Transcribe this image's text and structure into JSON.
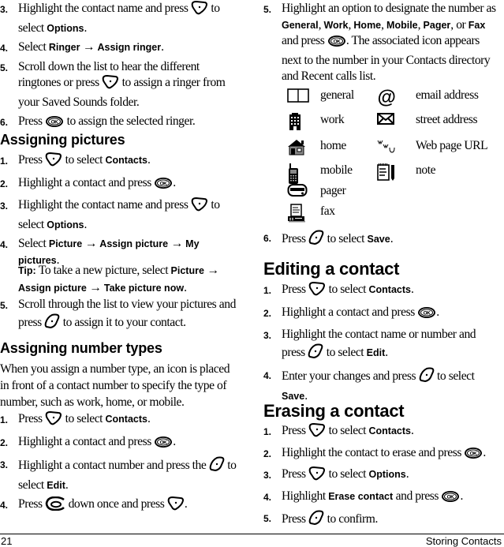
{
  "left": {
    "ringer_steps": [
      {
        "num": "3.",
        "parts": [
          "Highlight the contact name and press ",
          "{softkey-right}",
          " to select ",
          "**Options",
          "."
        ]
      },
      {
        "num": "4.",
        "parts": [
          "Select ",
          "**Ringer",
          " → ",
          "**Assign ringer",
          "."
        ]
      },
      {
        "num": "5.",
        "parts": [
          "Scroll down the list to hear the different ringtones or press ",
          "{softkey-right}",
          " to assign a ringer from your Saved Sounds folder."
        ]
      },
      {
        "num": "6.",
        "parts": [
          "Press ",
          "{ok}",
          " to assign the selected ringer."
        ]
      }
    ],
    "pictures_heading": "Assigning pictures",
    "pictures_steps": [
      {
        "num": "1.",
        "parts": [
          "Press ",
          "{softkey-right}",
          " to select ",
          "**Contacts",
          "."
        ]
      },
      {
        "num": "2.",
        "parts": [
          "Highlight a contact and press ",
          "{ok}",
          "."
        ]
      },
      {
        "num": "3.",
        "parts": [
          "Highlight the contact name and press ",
          "{softkey-right}",
          " to select ",
          "**Options",
          "."
        ]
      },
      {
        "num": "4.",
        "parts": [
          "Select ",
          "**Picture",
          " → ",
          "**Assign picture",
          " → ",
          "**My pictures",
          "."
        ]
      }
    ],
    "tip": {
      "label": "Tip:",
      "parts": [
        " To take a new picture, select ",
        "**Picture",
        " → ",
        "**Assign picture",
        " → ",
        "**Take picture now",
        "."
      ]
    },
    "pictures_step5": {
      "num": "5.",
      "parts": [
        "Scroll through the list to view your pictures and press ",
        "{softkey-left}",
        " to assign it to your contact."
      ]
    },
    "number_types_heading": "Assigning number types",
    "number_types_intro": "When you assign a number type, an icon is placed in front of a contact number to specify the type of number, such as work, home, or mobile.",
    "number_types_steps": [
      {
        "num": "1.",
        "parts": [
          "Press ",
          "{softkey-right}",
          " to select ",
          "**Contacts",
          "."
        ]
      },
      {
        "num": "2.",
        "parts": [
          "Highlight a contact and press ",
          "{ok}",
          "."
        ]
      },
      {
        "num": "3.",
        "parts": [
          "Highlight a contact number and press the ",
          "{softkey-left}",
          " to select ",
          "**Edit",
          "."
        ]
      },
      {
        "num": "4.",
        "parts": [
          "Press ",
          "{nav}",
          " down once and press ",
          "{softkey-right}",
          "."
        ]
      }
    ]
  },
  "right": {
    "number_types_step5": {
      "num": "5.",
      "parts": [
        "Highlight an option to designate the number as ",
        "**General",
        ", ",
        "**Work",
        ", ",
        "**Home",
        ", ",
        "**Mobile",
        ", ",
        "**Pager",
        ", or ",
        "**Fax",
        " and press ",
        "{ok}",
        ". The associated icon appears next to the number in your Contacts directory and Recent calls list."
      ]
    },
    "icon_table": [
      {
        "icon1": "book-icon",
        "label1": "general",
        "icon2": "at-sign-icon",
        "label2": "email address"
      },
      {
        "icon1": "building-icon",
        "label1": "work",
        "icon2": "envelope-icon",
        "label2": "street address"
      },
      {
        "icon1": "house-icon",
        "label1": "home",
        "icon2": "web-icon",
        "label2": "Web page URL"
      },
      {
        "icon1": "mobile-phone-icon",
        "label1": "mobile",
        "icon2": "notepad-icon",
        "label2": "note"
      },
      {
        "icon1": "pager-icon",
        "label1": "pager",
        "icon2": "",
        "label2": ""
      },
      {
        "icon1": "fax-icon",
        "label1": "fax",
        "icon2": "",
        "label2": ""
      }
    ],
    "number_types_step6": {
      "num": "6.",
      "parts": [
        "Press ",
        "{softkey-left}",
        " to select ",
        "**Save",
        "."
      ]
    },
    "editing_heading": "Editing a contact",
    "editing_steps": [
      {
        "num": "1.",
        "parts": [
          "Press ",
          "{softkey-right}",
          " to select ",
          "**Contacts",
          "."
        ]
      },
      {
        "num": "2.",
        "parts": [
          "Highlight a contact and press ",
          "{ok}",
          "."
        ]
      },
      {
        "num": "3.",
        "parts": [
          "Highlight the contact name or number and press ",
          "{softkey-left}",
          " to select ",
          "**Edit",
          "."
        ]
      },
      {
        "num": "4.",
        "parts": [
          "Enter your changes and press ",
          "{softkey-left}",
          " to select ",
          "**Save",
          "."
        ]
      }
    ],
    "erasing_heading": "Erasing a contact",
    "erasing_steps": [
      {
        "num": "1.",
        "parts": [
          "Press ",
          "{softkey-right}",
          " to select ",
          "**Contacts",
          "."
        ]
      },
      {
        "num": "2.",
        "parts": [
          "Highlight the contact to erase and press ",
          "{ok}",
          "."
        ]
      },
      {
        "num": "3.",
        "parts": [
          "Press ",
          "{softkey-right}",
          " to select ",
          "**Options",
          "."
        ]
      },
      {
        "num": "4.",
        "parts": [
          "Highlight ",
          "**Erase contact",
          " and press ",
          "{ok}",
          "."
        ]
      },
      {
        "num": "5.",
        "parts": [
          "Press ",
          "{softkey-left}",
          " to confirm."
        ]
      }
    ]
  },
  "footer": {
    "page_number": "21",
    "section_title": "Storing Contacts"
  }
}
